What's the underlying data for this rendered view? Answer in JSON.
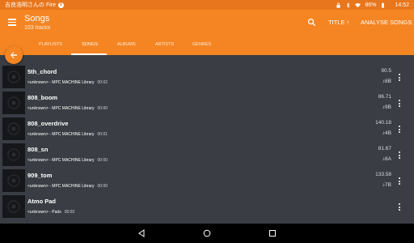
{
  "status": {
    "carrier": "吉良浩明さんの Fire",
    "notif_badge": "6",
    "battery": "86%",
    "time": "14:52"
  },
  "appbar": {
    "title": "Songs",
    "subtitle": "103 tracks",
    "sort_label": "TITLE ↑",
    "analyse_label": "ANALYSE SONGS"
  },
  "tabs": [
    {
      "label": "PLAYLISTS"
    },
    {
      "label": "SONGS"
    },
    {
      "label": "ALBUMS"
    },
    {
      "label": "ARTISTS"
    },
    {
      "label": "GENRES"
    }
  ],
  "songs": [
    {
      "title": "5th_chord",
      "artist": "<unknown> - MPC MACHINE Library",
      "duration": "00:02",
      "bpm": "90.5",
      "key": "♪8B"
    },
    {
      "title": "808_boom",
      "artist": "<unknown> - MPC MACHINE Library",
      "duration": "00:00",
      "bpm": "86.71",
      "key": "♪9B"
    },
    {
      "title": "808_overdrive",
      "artist": "<unknown> - MPC MACHINE Library",
      "duration": "00:01",
      "bpm": "140.18",
      "key": "♪4B"
    },
    {
      "title": "808_sn",
      "artist": "<unknown> - MPC MACHINE Library",
      "duration": "00:00",
      "bpm": "81.67",
      "key": "♪8A"
    },
    {
      "title": "909_tom",
      "artist": "<unknown> - MPC MACHINE Library",
      "duration": "00:00",
      "bpm": "133.58",
      "key": "♪7B"
    },
    {
      "title": "Atmo Pad",
      "artist": "<unknown> - Pads",
      "duration": "00:03",
      "bpm": "",
      "key": ""
    }
  ],
  "colors": {
    "accent": "#f58522",
    "status_bar": "#e8761c",
    "list_bg": "#3a3e44"
  },
  "icons": {
    "menu": "hamburger-icon",
    "search": "search-icon",
    "back": "arrow-back-icon",
    "more": "more-vert-icon",
    "nav_back": "triangle-back-icon",
    "nav_home": "circle-home-icon",
    "nav_recents": "square-recents-icon"
  }
}
